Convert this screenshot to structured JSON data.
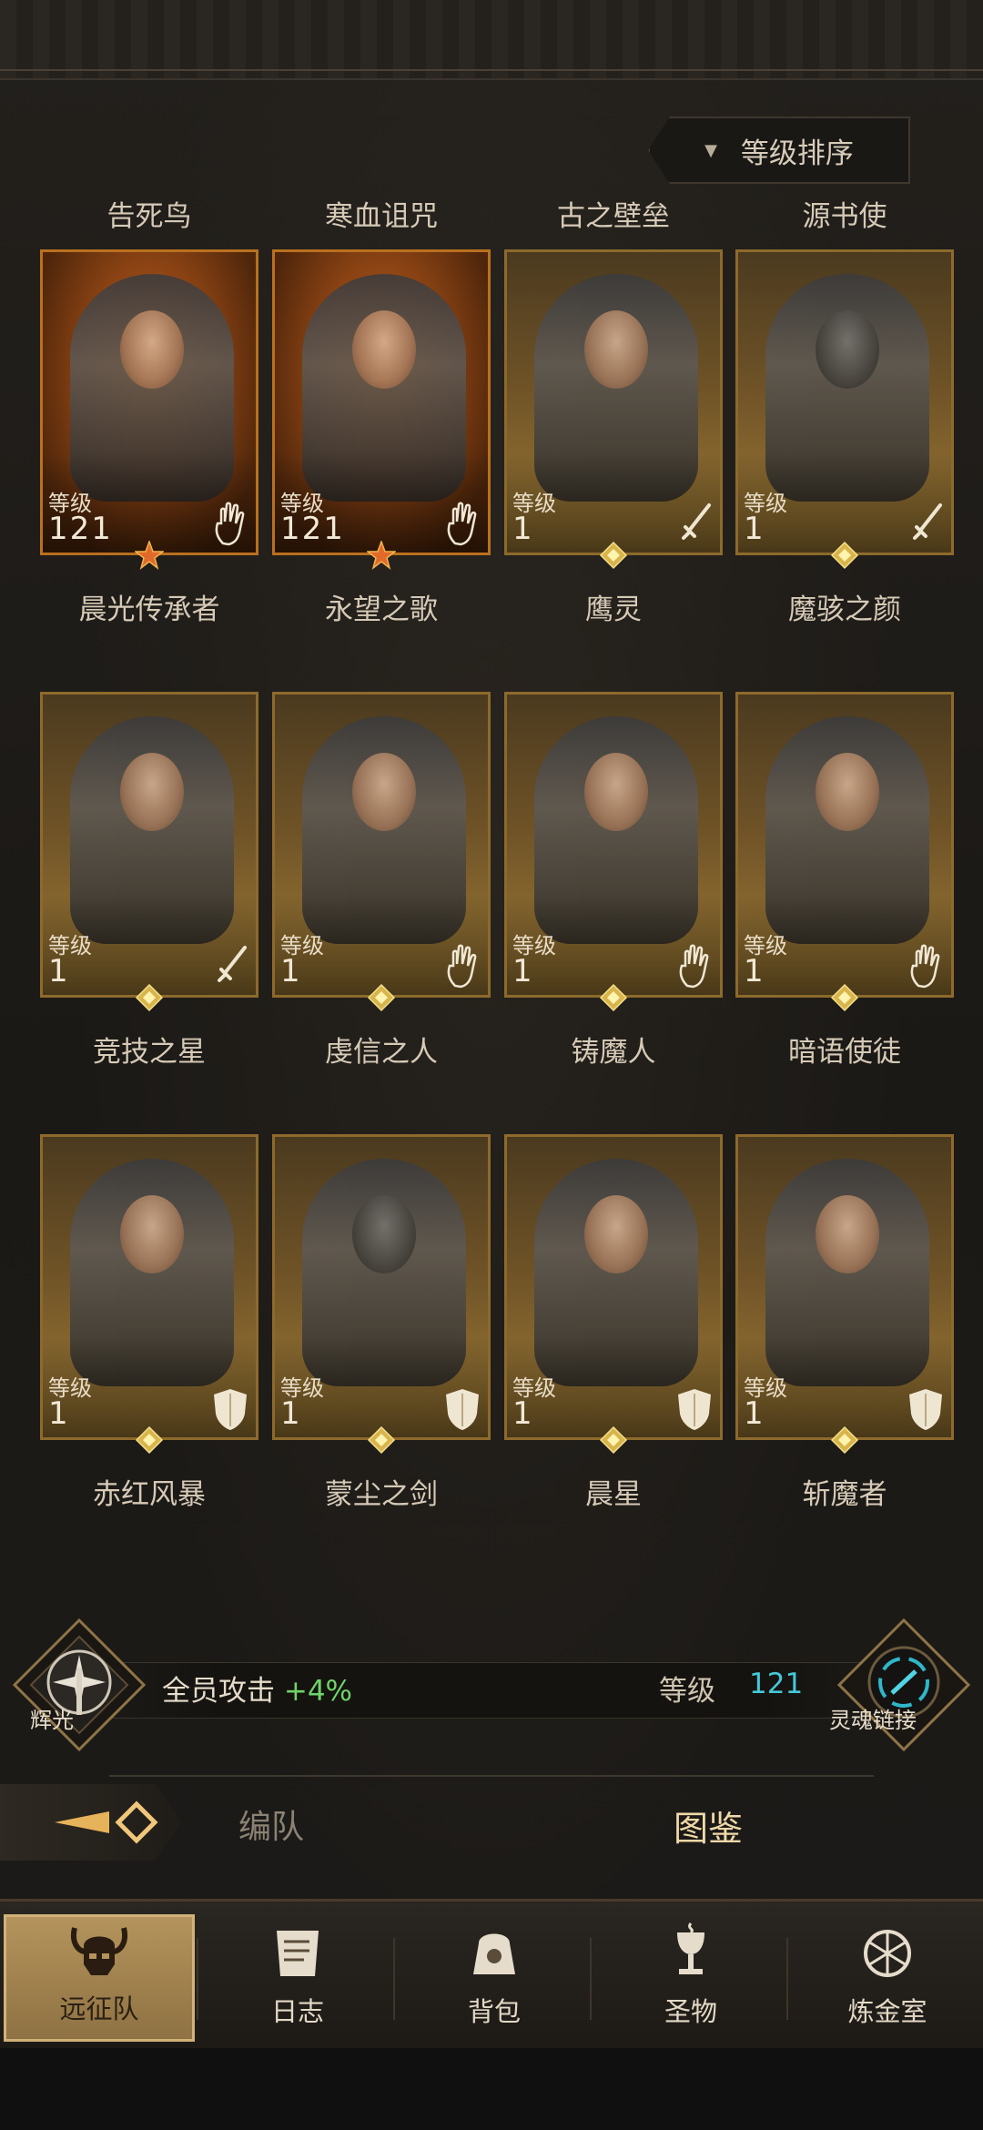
{
  "sort": {
    "label": "等级排序"
  },
  "heroes": [
    {
      "title": "告死鸟",
      "name": "晨光传承者",
      "level_label": "等级",
      "level": "121",
      "class_icon": "hand-icon",
      "frame": "orange"
    },
    {
      "title": "寒血诅咒",
      "name": "永望之歌",
      "level_label": "等级",
      "level": "121",
      "class_icon": "hand-icon",
      "frame": "orange"
    },
    {
      "title": "古之壁垒",
      "name": "鹰灵",
      "level_label": "等级",
      "level": "1",
      "class_icon": "sword-icon",
      "frame": "gold"
    },
    {
      "title": "源书使",
      "name": "魔骇之颜",
      "level_label": "等级",
      "level": "1",
      "class_icon": "sword-icon",
      "frame": "gold"
    },
    {
      "title": "",
      "name": "竞技之星",
      "level_label": "等级",
      "level": "1",
      "class_icon": "sword-icon",
      "frame": "gold"
    },
    {
      "title": "",
      "name": "虔信之人",
      "level_label": "等级",
      "level": "1",
      "class_icon": "hand-icon",
      "frame": "gold"
    },
    {
      "title": "",
      "name": "铸魔人",
      "level_label": "等级",
      "level": "1",
      "class_icon": "hand-icon",
      "frame": "gold"
    },
    {
      "title": "",
      "name": "暗语使徒",
      "level_label": "等级",
      "level": "1",
      "class_icon": "hand-icon",
      "frame": "gold"
    },
    {
      "title": "",
      "name": "赤红风暴",
      "level_label": "等级",
      "level": "1",
      "class_icon": "shield-icon",
      "frame": "gold"
    },
    {
      "title": "",
      "name": "蒙尘之剑",
      "level_label": "等级",
      "level": "1",
      "class_icon": "shield-icon",
      "frame": "gold"
    },
    {
      "title": "",
      "name": "晨星",
      "level_label": "等级",
      "level": "1",
      "class_icon": "shield-icon",
      "frame": "gold"
    },
    {
      "title": "",
      "name": "斩魔者",
      "level_label": "等级",
      "level": "1",
      "class_icon": "shield-icon",
      "frame": "gold"
    }
  ],
  "stats": {
    "radiance_label": "辉光",
    "attack_text": "全员攻击",
    "attack_bonus": "+4%",
    "level_label": "等级",
    "level_value": "121",
    "soul_link_label": "灵魂链接"
  },
  "tabs": {
    "formation": "编队",
    "codex": "图鉴"
  },
  "nav": [
    {
      "label": "远征队",
      "icon": "horned-helmet-icon",
      "active": true
    },
    {
      "label": "日志",
      "icon": "scroll-icon",
      "active": false
    },
    {
      "label": "背包",
      "icon": "bag-icon",
      "active": false
    },
    {
      "label": "圣物",
      "icon": "chalice-icon",
      "active": false
    },
    {
      "label": "炼金室",
      "icon": "alchemy-icon",
      "active": false
    }
  ],
  "colors": {
    "bonus": "#6fd36a",
    "level_value": "#45c8d8",
    "gold_frame": "#8d6a2c",
    "orange_frame": "#b9701f"
  }
}
